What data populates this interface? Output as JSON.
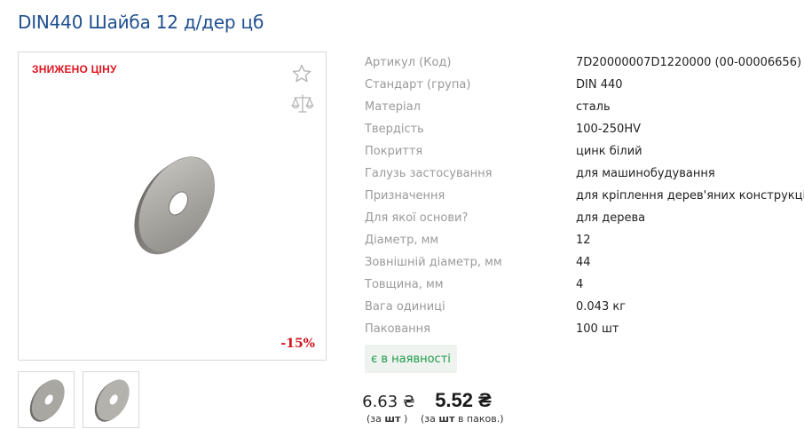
{
  "product": {
    "title": "DIN440 Шайба 12 д/дер цб",
    "sale_label": "ЗНИЖЕНО ЦІНУ",
    "discount": "-15%",
    "icons": [
      "star-icon",
      "scales-icon"
    ],
    "specs": [
      {
        "key": "Артикул (Код)",
        "value": "7D20000007D1220000 (00-00006656)"
      },
      {
        "key": "Стандарт (група)",
        "value": "DIN 440"
      },
      {
        "key": "Матеріал",
        "value": "сталь"
      },
      {
        "key": "Твердість",
        "value": "100-250HV"
      },
      {
        "key": "Покриття",
        "value": "цинк білий"
      },
      {
        "key": "Галузь застосування",
        "value": "для машинобудування"
      },
      {
        "key": "Призначення",
        "value": "для кріплення дерев'яних конструкцій"
      },
      {
        "key": "Для якої основи?",
        "value": "для дерева"
      },
      {
        "key": "Діаметр, мм",
        "value": "12"
      },
      {
        "key": "Зовнішній діаметр, мм",
        "value": "44"
      },
      {
        "key": "Товщина, мм",
        "value": "4"
      },
      {
        "key": "Вага одиниці",
        "value": "0.043 кг"
      },
      {
        "key": "Паковання",
        "value": "100 шт"
      }
    ],
    "stock": "є в наявності",
    "price": {
      "regular": "6.63 ₴",
      "regular_unit_prefix": "(за ",
      "regular_unit": "шт",
      "regular_unit_suffix": " )",
      "package": "5.52 ₴",
      "package_unit_prefix": "(за ",
      "package_unit": "шт",
      "package_unit_suffix": " в паков.)"
    },
    "colors": {
      "title": "#1f4f8f",
      "sale": "#e0141e",
      "stock": "#1e9a4a"
    }
  }
}
